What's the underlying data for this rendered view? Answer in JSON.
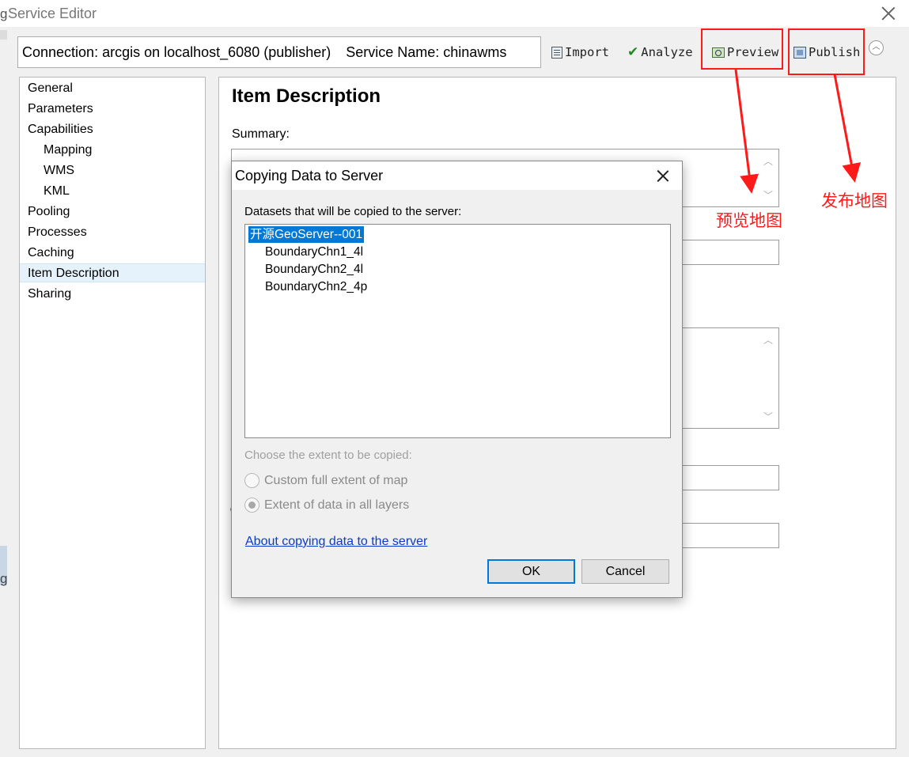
{
  "window": {
    "title": "Service Editor",
    "title_edge_glyph": "g",
    "left_edge_glyph": "g"
  },
  "toolbar": {
    "connection": "Connection: arcgis on localhost_6080 (publisher)",
    "service_name": "Service Name: chinawms",
    "import_label": "Import",
    "analyze_label": "Analyze",
    "preview_label": "Preview",
    "publish_label": "Publish",
    "collapse_glyph": "︿"
  },
  "sidebar": {
    "items": [
      {
        "label": "General",
        "level": 0
      },
      {
        "label": "Parameters",
        "level": 0
      },
      {
        "label": "Capabilities",
        "level": 0
      },
      {
        "label": "Mapping",
        "level": 1
      },
      {
        "label": "WMS",
        "level": 1
      },
      {
        "label": "KML",
        "level": 1
      },
      {
        "label": "Pooling",
        "level": 0
      },
      {
        "label": "Processes",
        "level": 0
      },
      {
        "label": "Caching",
        "level": 0
      },
      {
        "label": "Item Description",
        "level": 0,
        "selected": true
      },
      {
        "label": "Sharing",
        "level": 0
      }
    ]
  },
  "content": {
    "heading": "Item Description",
    "summary_label": "Summary:",
    "scroll_up": "︿",
    "scroll_down": "﹀"
  },
  "dialog": {
    "title": "Copying Data to Server",
    "datasets_label": "Datasets that will be copied to the server:",
    "datasets": [
      {
        "label": "开源GeoServer--001",
        "selected": true,
        "indent": 0
      },
      {
        "label": "BoundaryChn1_4l",
        "selected": false,
        "indent": 1
      },
      {
        "label": "BoundaryChn2_4l",
        "selected": false,
        "indent": 1
      },
      {
        "label": "BoundaryChn2_4p",
        "selected": false,
        "indent": 1
      }
    ],
    "extent_label": "Choose the extent to be copied:",
    "radio_custom": "Custom full extent of map",
    "radio_all_layers": "Extent of data in all layers",
    "selected_option": "Extent of data in all layers",
    "about_link": "About copying data to the server",
    "ok_label": "OK",
    "cancel_label": "Cancel"
  },
  "annotations": {
    "preview_note": "预览地图",
    "publish_note": "发布地图",
    "color": "#ff1a1a"
  },
  "colors": {
    "selection": "#0078d7",
    "nav_selected": "#e5f1fb",
    "link": "#0b3bcc"
  }
}
